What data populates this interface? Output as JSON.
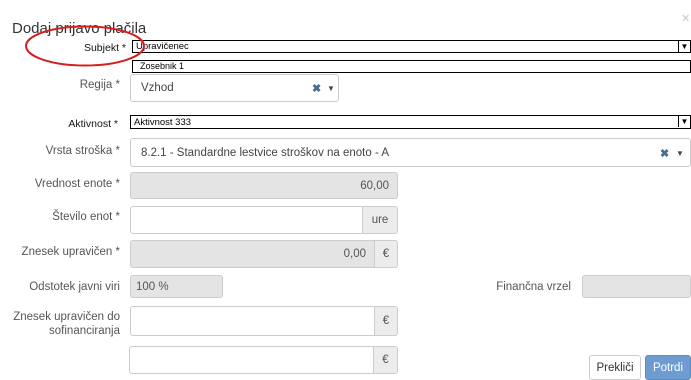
{
  "modal": {
    "title": "Dodaj prijavo plačila",
    "close_icon": "close-icon"
  },
  "fields": {
    "subjekt": {
      "label": "Subjekt *",
      "value": "Upravičenec",
      "dropdown_option": "Zosebnik 1"
    },
    "regija": {
      "label": "Regija *",
      "value": "Vzhod"
    },
    "aktivnost": {
      "label": "Aktivnost *",
      "value": "Aktivnost 333"
    },
    "vrsta_stroska": {
      "label": "Vrsta stroška *",
      "value": "8.2.1 - Standardne lestvice stroškov na enoto - A"
    },
    "vrednost_enote": {
      "label": "Vrednost enote *",
      "value": "60,00"
    },
    "stevilo_enot": {
      "label": "Število enot *",
      "value": "",
      "unit": "ure"
    },
    "znesek_upravicen": {
      "label": "Znesek upravičen *",
      "value": "0,00",
      "unit": "€"
    },
    "odstotek_javni_viri": {
      "label": "Odstotek javni viri",
      "value": "100 %"
    },
    "financna_vrzel": {
      "label": "Finančna vrzel",
      "value": ""
    },
    "znesek_sofinanciranja": {
      "label_line1": "Znesek upravičen do",
      "label_line2": "sofinanciranja",
      "value": "",
      "unit": "€"
    },
    "extra_amount": {
      "value": "",
      "unit": "€"
    }
  },
  "buttons": {
    "cancel": "Prekliči",
    "confirm": "Potrdi"
  },
  "icons": {
    "clear": "✖",
    "caret": "▼"
  },
  "colors": {
    "primary": "#6f9cd0",
    "annotation": "#d42020"
  }
}
